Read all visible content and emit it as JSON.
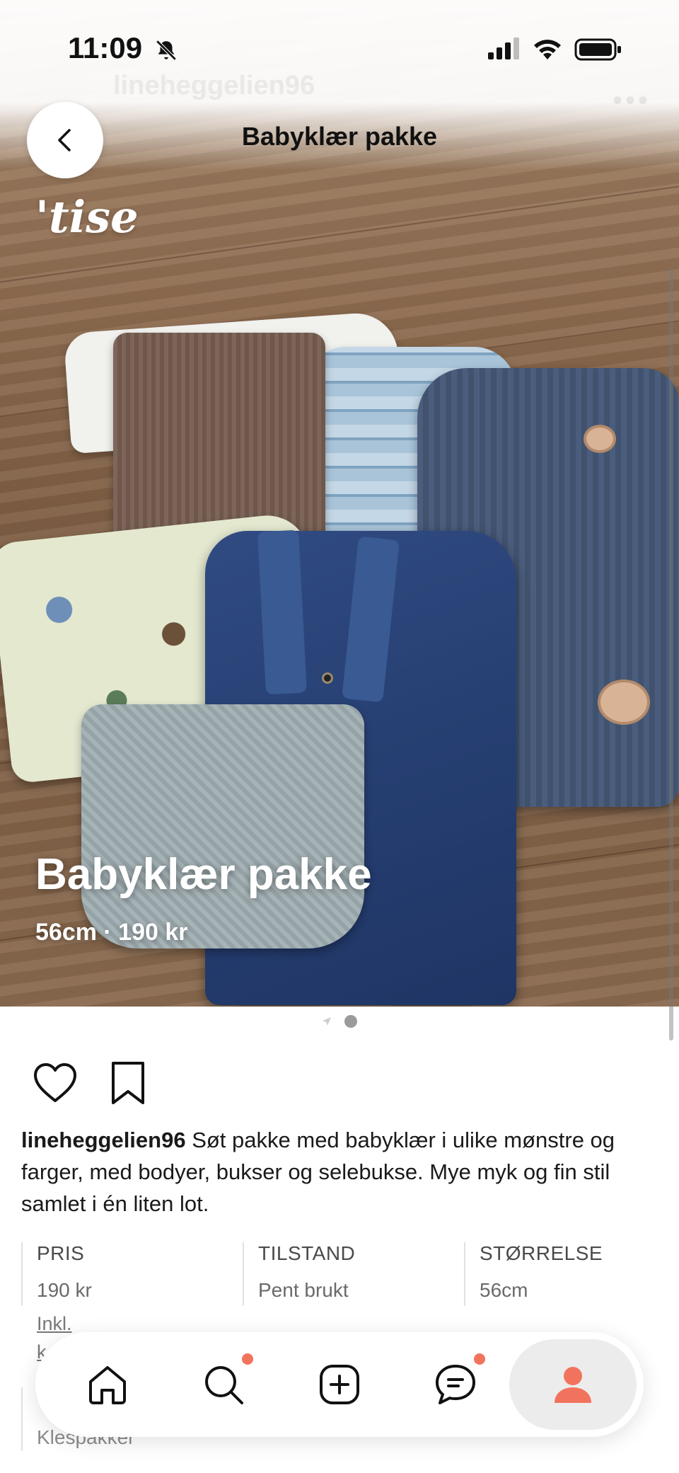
{
  "status_bar": {
    "time": "11:09"
  },
  "nav": {
    "title": "Babyklær pakke"
  },
  "photo": {
    "brand": "'tise",
    "title": "Babyklær pakke",
    "meta": "56cm · 190 kr"
  },
  "post": {
    "username": "lineheggelien96",
    "description": " Søt pakke med babyklær i ulike mønstre og farger, med bodyer, bukser og selebukse. Mye myk og fin stil samlet i én liten lot."
  },
  "details": {
    "price_label": "PRIS",
    "price_value": "190 kr",
    "condition_label": "TILSTAND",
    "condition_value": "Pent brukt",
    "size_label": "STØRRELSE",
    "size_value": "56cm",
    "inkl_link": "Inkl.",
    "inkl_link_2": "k",
    "category_value": "Klespakker"
  },
  "tabbar": {
    "items": [
      {
        "icon": "home-icon",
        "notification": false
      },
      {
        "icon": "search-icon",
        "notification": true
      },
      {
        "icon": "add-icon",
        "notification": false
      },
      {
        "icon": "chat-icon",
        "notification": true
      },
      {
        "icon": "profile-icon",
        "notification": false,
        "active": true
      }
    ]
  },
  "colors": {
    "accent": "#f2735d",
    "text": "#1a1a1a",
    "muted": "#6a6a6a"
  }
}
